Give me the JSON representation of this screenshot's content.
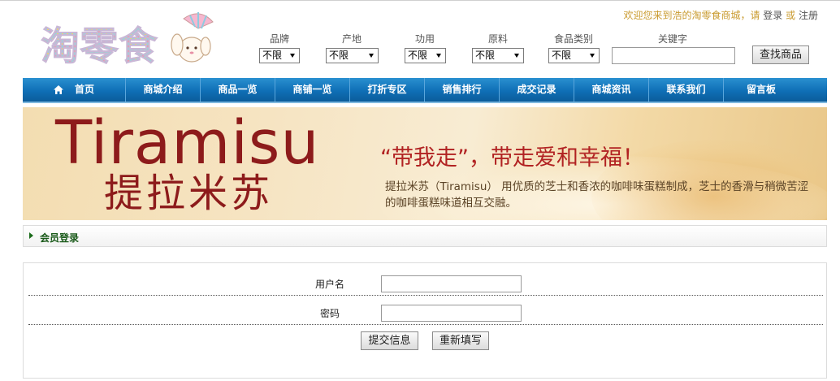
{
  "header": {
    "logo_text": "淘零食",
    "welcome": {
      "prefix": "欢迎您来到浩的淘零食商城，请",
      "login": "登录",
      "or": "或",
      "register": "注册"
    },
    "filters": [
      {
        "label": "品牌",
        "value": "不限"
      },
      {
        "label": "产地",
        "value": "不限"
      },
      {
        "label": "功用",
        "value": "不限"
      },
      {
        "label": "原料",
        "value": "不限"
      },
      {
        "label": "食品类别",
        "value": "不限"
      }
    ],
    "keyword_label": "关键字",
    "keyword_value": "",
    "search_button": "查找商品"
  },
  "nav": {
    "items": [
      {
        "label": "首页",
        "icon": "home-icon"
      },
      {
        "label": "商城介绍"
      },
      {
        "label": "商品一览"
      },
      {
        "label": "商铺一览"
      },
      {
        "label": "打折专区"
      },
      {
        "label": "销售排行"
      },
      {
        "label": "成交记录"
      },
      {
        "label": "商城资讯"
      },
      {
        "label": "联系我们"
      },
      {
        "label": "留言板"
      }
    ]
  },
  "banner": {
    "title_en": "Tiramisu",
    "title_cn": "提拉米苏",
    "slogan": "“带我走”，带走爱和幸福！",
    "description": "提拉米苏（Tiramisu） 用优质的芝士和香浓的咖啡味蛋糕制成，芝士的香滑与稍微苦涩的咖啡蛋糕味道相互交融。"
  },
  "section": {
    "title": "会员登录"
  },
  "login": {
    "username_label": "用户名",
    "username_value": "",
    "password_label": "密码",
    "password_value": "",
    "submit_button": "提交信息",
    "reset_button": "重新填写"
  },
  "colors": {
    "nav_blue": "#1478be",
    "welcome_gold": "#c99a2e",
    "banner_red": "#8d1b1b",
    "section_green": "#1a5a1a"
  }
}
